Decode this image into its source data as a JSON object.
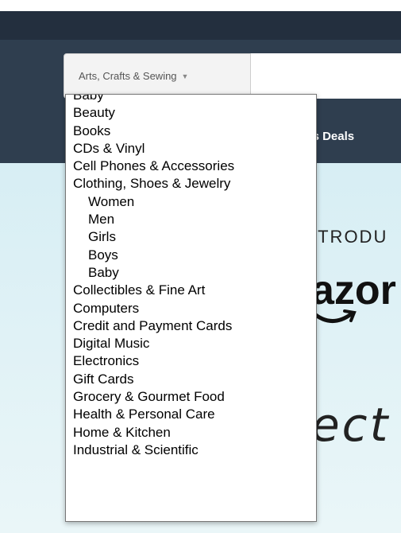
{
  "search": {
    "category_selected": "Arts, Crafts & Sewing",
    "caret_icon": "▼"
  },
  "nav": {
    "deals_partial": "'s Deals"
  },
  "hero": {
    "introducing_partial": "ITRODU",
    "brand_partial": "azor",
    "echo_partial": "ect"
  },
  "dropdown": {
    "options": [
      {
        "label": "Baby",
        "sub": false
      },
      {
        "label": "Beauty",
        "sub": false
      },
      {
        "label": "Books",
        "sub": false
      },
      {
        "label": "CDs & Vinyl",
        "sub": false
      },
      {
        "label": "Cell Phones & Accessories",
        "sub": false
      },
      {
        "label": "Clothing, Shoes & Jewelry",
        "sub": false
      },
      {
        "label": "Women",
        "sub": true
      },
      {
        "label": "Men",
        "sub": true
      },
      {
        "label": "Girls",
        "sub": true
      },
      {
        "label": "Boys",
        "sub": true
      },
      {
        "label": "Baby",
        "sub": true
      },
      {
        "label": "Collectibles & Fine Art",
        "sub": false
      },
      {
        "label": "Computers",
        "sub": false
      },
      {
        "label": "Credit and Payment Cards",
        "sub": false
      },
      {
        "label": "Digital Music",
        "sub": false
      },
      {
        "label": "Electronics",
        "sub": false
      },
      {
        "label": "Gift Cards",
        "sub": false
      },
      {
        "label": "Grocery & Gourmet Food",
        "sub": false
      },
      {
        "label": "Health & Personal Care",
        "sub": false
      },
      {
        "label": "Home & Kitchen",
        "sub": false
      },
      {
        "label": "Industrial & Scientific",
        "sub": false
      }
    ]
  }
}
